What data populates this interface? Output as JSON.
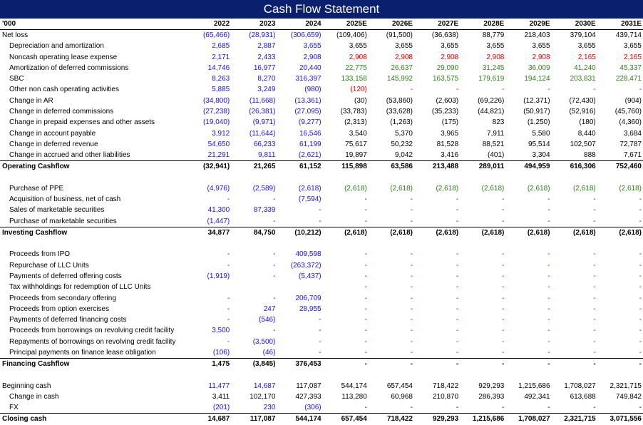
{
  "title": "Cash Flow Statement",
  "header": {
    "unit": "'000",
    "years": [
      "2022",
      "2023",
      "2024",
      "2025E",
      "2026E",
      "2027E",
      "2028E",
      "2029E",
      "2030E",
      "2031E"
    ]
  },
  "colors": {
    "historical": "#1b14d6",
    "projection": "#000000",
    "assumption_red": "#e00000",
    "assumption_green": "#2e7d19",
    "title_bg": "#0a1f6e"
  },
  "rows": [
    {
      "label": "Net loss",
      "style": "plain",
      "values": [
        "(65,466)",
        "(28,931)",
        "(306,659)",
        "(109,406)",
        "(91,500)",
        "(36,638)",
        "88,779",
        "218,403",
        "379,104",
        "439,714"
      ],
      "colors": [
        "h",
        "h",
        "h",
        "k",
        "k",
        "k",
        "k",
        "k",
        "k",
        "k"
      ]
    },
    {
      "label": "Depreciation and amortization",
      "style": "ind",
      "values": [
        "2,685",
        "2,887",
        "3,655",
        "3,655",
        "3,655",
        "3,655",
        "3,655",
        "3,655",
        "3,655",
        "3,655"
      ],
      "colors": [
        "h",
        "h",
        "h",
        "k",
        "k",
        "k",
        "k",
        "k",
        "k",
        "k"
      ]
    },
    {
      "label": "Noncash operating lease expense",
      "style": "ind",
      "values": [
        "2,171",
        "2,433",
        "2,908",
        "2,908",
        "2,908",
        "2,908",
        "2,908",
        "2,908",
        "2,165",
        "2,165"
      ],
      "colors": [
        "h",
        "h",
        "h",
        "r",
        "r",
        "r",
        "r",
        "r",
        "r",
        "r"
      ]
    },
    {
      "label": "Amortization of deferred commissions",
      "style": "ind",
      "values": [
        "14,746",
        "16,977",
        "20,440",
        "22,775",
        "26,637",
        "29,090",
        "31,245",
        "36,009",
        "41,240",
        "45,337"
      ],
      "colors": [
        "h",
        "h",
        "h",
        "g",
        "g",
        "g",
        "g",
        "g",
        "g",
        "g"
      ]
    },
    {
      "label": "SBC",
      "style": "ind",
      "values": [
        "8,263",
        "8,270",
        "316,397",
        "133,158",
        "145,992",
        "163,575",
        "179,619",
        "194,124",
        "203,831",
        "228,471"
      ],
      "colors": [
        "h",
        "h",
        "h",
        "g",
        "g",
        "g",
        "g",
        "g",
        "g",
        "g"
      ]
    },
    {
      "label": "Other non cash operating activities",
      "style": "ind",
      "values": [
        "5,885",
        "3,249",
        "(980)",
        "(120)",
        "-",
        "-",
        "-",
        "-",
        "-",
        "-"
      ],
      "colors": [
        "h",
        "h",
        "h",
        "r",
        "r",
        "r",
        "r",
        "r",
        "r",
        "r"
      ]
    },
    {
      "label": "Change in AR",
      "style": "ind",
      "values": [
        "(34,800)",
        "(11,668)",
        "(13,361)",
        "(30)",
        "(53,860)",
        "(2,603)",
        "(69,226)",
        "(12,371)",
        "(72,430)",
        "(904)"
      ],
      "colors": [
        "h",
        "h",
        "h",
        "k",
        "k",
        "k",
        "k",
        "k",
        "k",
        "k"
      ]
    },
    {
      "label": "Change in deferred commissions",
      "style": "ind",
      "values": [
        "(27,238)",
        "(26,381)",
        "(27,095)",
        "(33,783)",
        "(33,628)",
        "(35,233)",
        "(44,821)",
        "(50,917)",
        "(52,916)",
        "(45,760)"
      ],
      "colors": [
        "h",
        "h",
        "h",
        "k",
        "k",
        "k",
        "k",
        "k",
        "k",
        "k"
      ]
    },
    {
      "label": "Change in prepaid expenses and other assets",
      "style": "ind",
      "values": [
        "(19,040)",
        "(9,971)",
        "(9,277)",
        "(2,313)",
        "(1,263)",
        "(175)",
        "823",
        "(1,250)",
        "(180)",
        "(4,360)"
      ],
      "colors": [
        "h",
        "h",
        "h",
        "k",
        "k",
        "k",
        "k",
        "k",
        "k",
        "k"
      ]
    },
    {
      "label": "Change in account payable",
      "style": "ind",
      "values": [
        "3,912",
        "(11,644)",
        "16,546",
        "3,540",
        "5,370",
        "3,965",
        "7,911",
        "5,580",
        "8,440",
        "3,684"
      ],
      "colors": [
        "h",
        "h",
        "h",
        "k",
        "k",
        "k",
        "k",
        "k",
        "k",
        "k"
      ]
    },
    {
      "label": "Change in deferred revenue",
      "style": "ind",
      "values": [
        "54,650",
        "66,233",
        "61,199",
        "75,617",
        "50,232",
        "81,528",
        "88,521",
        "95,514",
        "102,507",
        "72,787"
      ],
      "colors": [
        "h",
        "h",
        "h",
        "k",
        "k",
        "k",
        "k",
        "k",
        "k",
        "k"
      ]
    },
    {
      "label": "Change in accrued and other liabilities",
      "style": "ind",
      "values": [
        "21,291",
        "9,811",
        "(2,621)",
        "19,897",
        "9,042",
        "3,416",
        "(401)",
        "3,304",
        "888",
        "7,671"
      ],
      "colors": [
        "h",
        "h",
        "h",
        "k",
        "k",
        "k",
        "k",
        "k",
        "k",
        "k"
      ]
    },
    {
      "label": "Operating Cashflow",
      "style": "total",
      "values": [
        "(32,941)",
        "21,265",
        "61,152",
        "115,898",
        "63,586",
        "213,488",
        "289,011",
        "494,959",
        "616,306",
        "752,460"
      ],
      "colors": [
        "k",
        "k",
        "k",
        "k",
        "k",
        "k",
        "k",
        "k",
        "k",
        "k"
      ]
    },
    {
      "label": "",
      "style": "blank",
      "values": [
        "",
        "",
        "",
        "",
        "",
        "",
        "",
        "",
        "",
        ""
      ],
      "colors": [
        "k",
        "k",
        "k",
        "k",
        "k",
        "k",
        "k",
        "k",
        "k",
        "k"
      ]
    },
    {
      "label": "Purchase of PPE",
      "style": "ind",
      "values": [
        "(4,976)",
        "(2,589)",
        "(2,618)",
        "(2,618)",
        "(2,618)",
        "(2,618)",
        "(2,618)",
        "(2,618)",
        "(2,618)",
        "(2,618)"
      ],
      "colors": [
        "h",
        "h",
        "h",
        "g",
        "g",
        "g",
        "g",
        "g",
        "g",
        "g"
      ]
    },
    {
      "label": "Acquisition of business, net of cash",
      "style": "ind",
      "values": [
        "-",
        "-",
        "(7,594)",
        "-",
        "-",
        "-",
        "-",
        "-",
        "-",
        "-"
      ],
      "colors": [
        "h",
        "h",
        "h",
        "h",
        "h",
        "h",
        "h",
        "h",
        "h",
        "h"
      ]
    },
    {
      "label": "Sales of marketable securities",
      "style": "ind",
      "values": [
        "41,300",
        "87,339",
        "-",
        "-",
        "-",
        "-",
        "-",
        "-",
        "-",
        "-"
      ],
      "colors": [
        "h",
        "h",
        "h",
        "h",
        "h",
        "h",
        "h",
        "h",
        "h",
        "h"
      ]
    },
    {
      "label": "Purchase of marketable securities",
      "style": "ind",
      "values": [
        "(1,447)",
        "-",
        "-",
        "-",
        "-",
        "-",
        "-",
        "-",
        "-",
        "-"
      ],
      "colors": [
        "h",
        "h",
        "h",
        "h",
        "h",
        "h",
        "h",
        "h",
        "h",
        "h"
      ]
    },
    {
      "label": "Investing Cashflow",
      "style": "total",
      "values": [
        "34,877",
        "84,750",
        "(10,212)",
        "(2,618)",
        "(2,618)",
        "(2,618)",
        "(2,618)",
        "(2,618)",
        "(2,618)",
        "(2,618)"
      ],
      "colors": [
        "k",
        "k",
        "k",
        "k",
        "k",
        "k",
        "k",
        "k",
        "k",
        "k"
      ]
    },
    {
      "label": "",
      "style": "blank",
      "values": [
        "",
        "",
        "",
        "",
        "",
        "",
        "",
        "",
        "",
        ""
      ],
      "colors": [
        "k",
        "k",
        "k",
        "k",
        "k",
        "k",
        "k",
        "k",
        "k",
        "k"
      ]
    },
    {
      "label": "Proceeds from IPO",
      "style": "ind",
      "values": [
        "-",
        "-",
        "409,598",
        "-",
        "-",
        "-",
        "-",
        "-",
        "-",
        "-"
      ],
      "colors": [
        "h",
        "h",
        "h",
        "r",
        "r",
        "r",
        "r",
        "r",
        "r",
        "r"
      ]
    },
    {
      "label": "Repurchase of LLC Units",
      "style": "ind",
      "values": [
        "-",
        "-",
        "(263,372)",
        "-",
        "-",
        "-",
        "-",
        "-",
        "-",
        "-"
      ],
      "colors": [
        "h",
        "h",
        "h",
        "r",
        "r",
        "r",
        "r",
        "r",
        "r",
        "r"
      ]
    },
    {
      "label": "Payments of deferred offering costs",
      "style": "ind",
      "values": [
        "(1,919)",
        "-",
        "(5,437)",
        "-",
        "-",
        "-",
        "-",
        "-",
        "-",
        "-"
      ],
      "colors": [
        "h",
        "h",
        "h",
        "r",
        "r",
        "r",
        "r",
        "r",
        "r",
        "r"
      ]
    },
    {
      "label": "Tax withholdings for redemption of LLC Units",
      "style": "ind",
      "values": [
        "",
        "",
        "",
        "-",
        "-",
        "-",
        "-",
        "-",
        "-",
        "-"
      ],
      "colors": [
        "h",
        "h",
        "h",
        "r",
        "r",
        "r",
        "r",
        "r",
        "r",
        "r"
      ]
    },
    {
      "label": "Proceeds from secondary offering",
      "style": "ind",
      "values": [
        "-",
        "-",
        "206,709",
        "-",
        "-",
        "-",
        "-",
        "-",
        "-",
        "-"
      ],
      "colors": [
        "h",
        "h",
        "h",
        "r",
        "r",
        "r",
        "r",
        "r",
        "r",
        "r"
      ]
    },
    {
      "label": "Proceeds from option exercises",
      "style": "ind",
      "values": [
        "-",
        "247",
        "28,955",
        "-",
        "-",
        "-",
        "-",
        "-",
        "-",
        "-"
      ],
      "colors": [
        "h",
        "h",
        "h",
        "r",
        "r",
        "r",
        "r",
        "r",
        "r",
        "r"
      ]
    },
    {
      "label": "Payments of deferred financing costs",
      "style": "ind",
      "values": [
        "-",
        "(546)",
        "-",
        "-",
        "-",
        "-",
        "-",
        "-",
        "-",
        "-"
      ],
      "colors": [
        "h",
        "h",
        "h",
        "r",
        "r",
        "r",
        "r",
        "r",
        "r",
        "r"
      ]
    },
    {
      "label": "Proceeds from borrowings on revolving credit facility",
      "style": "ind",
      "values": [
        "3,500",
        "-",
        "-",
        "-",
        "-",
        "-",
        "-",
        "-",
        "-",
        "-"
      ],
      "colors": [
        "h",
        "h",
        "h",
        "r",
        "r",
        "r",
        "r",
        "r",
        "r",
        "r"
      ]
    },
    {
      "label": "Repayments of borrowings on revolving credit facility",
      "style": "ind",
      "values": [
        "-",
        "(3,500)",
        "-",
        "-",
        "-",
        "-",
        "-",
        "-",
        "-",
        "-"
      ],
      "colors": [
        "h",
        "h",
        "h",
        "r",
        "r",
        "r",
        "r",
        "r",
        "r",
        "r"
      ]
    },
    {
      "label": "Principal payments on finance lease obligation",
      "style": "ind",
      "values": [
        "(106)",
        "(46)",
        "-",
        "-",
        "-",
        "-",
        "-",
        "-",
        "-",
        "-"
      ],
      "colors": [
        "h",
        "h",
        "h",
        "r",
        "r",
        "r",
        "r",
        "r",
        "r",
        "r"
      ]
    },
    {
      "label": "Financing Cashflow",
      "style": "total",
      "values": [
        "1,475",
        "(3,845)",
        "376,453",
        "-",
        "-",
        "-",
        "-",
        "-",
        "-",
        "-"
      ],
      "colors": [
        "k",
        "k",
        "k",
        "k",
        "k",
        "k",
        "k",
        "k",
        "k",
        "k"
      ]
    },
    {
      "label": "",
      "style": "blank",
      "values": [
        "",
        "",
        "",
        "",
        "",
        "",
        "",
        "",
        "",
        ""
      ],
      "colors": [
        "k",
        "k",
        "k",
        "k",
        "k",
        "k",
        "k",
        "k",
        "k",
        "k"
      ]
    },
    {
      "label": "Beginning cash",
      "style": "plain",
      "values": [
        "11,477",
        "14,687",
        "117,087",
        "544,174",
        "657,454",
        "718,422",
        "929,293",
        "1,215,686",
        "1,708,027",
        "2,321,715"
      ],
      "colors": [
        "h",
        "h",
        "k",
        "k",
        "k",
        "k",
        "k",
        "k",
        "k",
        "k"
      ]
    },
    {
      "label": "Change in cash",
      "style": "ind",
      "values": [
        "3,411",
        "102,170",
        "427,393",
        "113,280",
        "60,968",
        "210,870",
        "286,393",
        "492,341",
        "613,688",
        "749,842"
      ],
      "colors": [
        "k",
        "k",
        "k",
        "k",
        "k",
        "k",
        "k",
        "k",
        "k",
        "k"
      ]
    },
    {
      "label": "FX",
      "style": "ind",
      "values": [
        "(201)",
        "230",
        "(306)",
        "-",
        "-",
        "-",
        "-",
        "-",
        "-",
        "-"
      ],
      "colors": [
        "h",
        "h",
        "h",
        "k",
        "k",
        "k",
        "k",
        "k",
        "k",
        "k"
      ]
    },
    {
      "label": "Closing cash",
      "style": "total",
      "values": [
        "14,687",
        "117,087",
        "544,174",
        "657,454",
        "718,422",
        "929,293",
        "1,215,686",
        "1,708,027",
        "2,321,715",
        "3,071,556"
      ],
      "colors": [
        "k",
        "k",
        "k",
        "k",
        "k",
        "k",
        "k",
        "k",
        "k",
        "k"
      ]
    }
  ]
}
